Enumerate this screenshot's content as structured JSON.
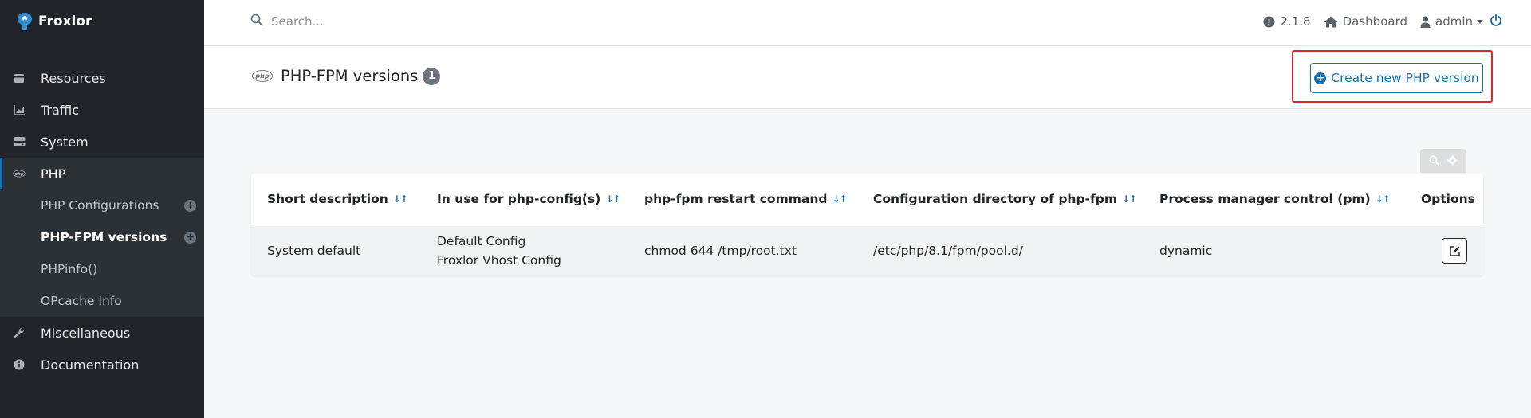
{
  "app": {
    "name": "Froxlor"
  },
  "topbar": {
    "search_placeholder": "Search...",
    "version": "2.1.8",
    "dashboard_label": "Dashboard",
    "user_label": "admin"
  },
  "sidebar": {
    "items": [
      {
        "label": "Resources",
        "icon": "box-icon"
      },
      {
        "label": "Traffic",
        "icon": "chart-area-icon"
      },
      {
        "label": "System",
        "icon": "server-icon"
      },
      {
        "label": "PHP",
        "icon": "php-icon"
      }
    ],
    "php_subitems": [
      {
        "label": "PHP Configurations",
        "has_add": true
      },
      {
        "label": "PHP-FPM versions",
        "has_add": true,
        "current": true
      },
      {
        "label": "PHPinfo()"
      },
      {
        "label": "OPcache Info"
      }
    ],
    "bottom_items": [
      {
        "label": "Miscellaneous",
        "icon": "wrench-icon"
      },
      {
        "label": "Documentation",
        "icon": "info-icon"
      }
    ]
  },
  "page": {
    "title": "PHP-FPM versions",
    "count": "1",
    "create_button_label": "Create new PHP version"
  },
  "table": {
    "columns": [
      "Short description",
      "In use for php-config(s)",
      "php-fpm restart command",
      "Configuration directory of php-fpm",
      "Process manager control (pm)",
      "Options"
    ],
    "sort_indicator": "↓↑",
    "rows": [
      {
        "short_description": "System default",
        "in_use": [
          "Default Config",
          "Froxlor Vhost Config"
        ],
        "restart_command": "chmod 644 /tmp/root.txt",
        "config_dir": "/etc/php/8.1/fpm/pool.d/",
        "pm": "dynamic"
      }
    ]
  },
  "colors": {
    "accent": "#1a6fa8",
    "sidebar_bg": "#212529",
    "highlight": "#d9272e"
  }
}
